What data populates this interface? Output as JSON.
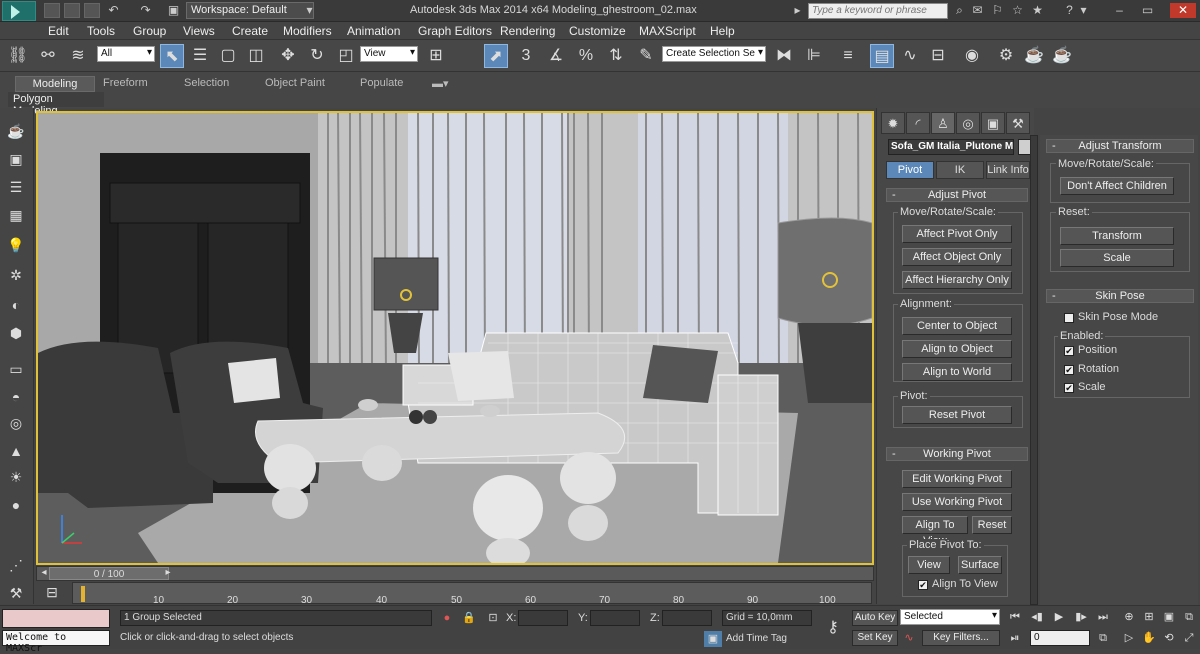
{
  "titlebar": {
    "workspace": "Workspace: Default",
    "app_title": "Autodesk 3ds Max  2014 x64      Modeling_ghestroom_02.max",
    "search_placeholder": "Type a keyword or phrase"
  },
  "menu": [
    "Edit",
    "Tools",
    "Group",
    "Views",
    "Create",
    "Modifiers",
    "Animation",
    "Graph Editors",
    "Rendering",
    "Customize",
    "MAXScript",
    "Help"
  ],
  "toolbar": {
    "selection_filter": "All",
    "ref_coord": "View",
    "snap_count": "3",
    "named_selection_placeholder": "Create Selection Se"
  },
  "ribbon": {
    "tabs": [
      "Modeling",
      "Freeform",
      "Selection",
      "Object Paint",
      "Populate"
    ],
    "panel_label": "Polygon Modeling"
  },
  "timeline": {
    "frame_label": "0 / 100",
    "ticks": [
      "10",
      "20",
      "30",
      "40",
      "50",
      "60",
      "70",
      "80",
      "90",
      "100"
    ]
  },
  "cmdpanel": {
    "object_name": "Sofa_GM Italia_Plutone M",
    "subtabs": [
      "Pivot",
      "IK",
      "Link Info"
    ],
    "adjust_pivot": {
      "title": "Adjust Pivot",
      "move_label": "Move/Rotate/Scale:",
      "affect_pivot": "Affect Pivot Only",
      "affect_object": "Affect Object Only",
      "affect_hierarchy": "Affect Hierarchy Only",
      "alignment_label": "Alignment:",
      "center_to_object": "Center to Object",
      "align_to_object": "Align to Object",
      "align_to_world": "Align to World",
      "pivot_label": "Pivot:",
      "reset_pivot": "Reset Pivot"
    },
    "working_pivot": {
      "title": "Working Pivot",
      "edit": "Edit Working Pivot",
      "use": "Use Working Pivot",
      "align_to_view": "Align To View",
      "reset": "Reset",
      "place_label": "Place Pivot To:",
      "view": "View",
      "surface": "Surface",
      "align_to_view_chk": "Align To View"
    }
  },
  "extrapanel": {
    "adjust_transform": {
      "title": "Adjust Transform",
      "move_label": "Move/Rotate/Scale:",
      "dont_affect": "Don't Affect Children",
      "reset_label": "Reset:",
      "transform": "Transform",
      "scale": "Scale"
    },
    "skin_pose": {
      "title": "Skin Pose",
      "mode": "Skin Pose Mode",
      "enabled_label": "Enabled:",
      "position": "Position",
      "rotation": "Rotation",
      "scale": "Scale"
    }
  },
  "status": {
    "maxscript": "Welcome to MAXScr",
    "selected": "1 Group Selected",
    "prompt": "Click or click-and-drag to select objects",
    "x_label": "X:",
    "y_label": "Y:",
    "z_label": "Z:",
    "grid": "Grid = 10,0mm",
    "add_time_tag": "Add Time Tag",
    "auto_key": "Auto Key",
    "set_key": "Set Key",
    "key_mode": "Selected",
    "key_filters": "Key Filters...",
    "frame": "0"
  }
}
